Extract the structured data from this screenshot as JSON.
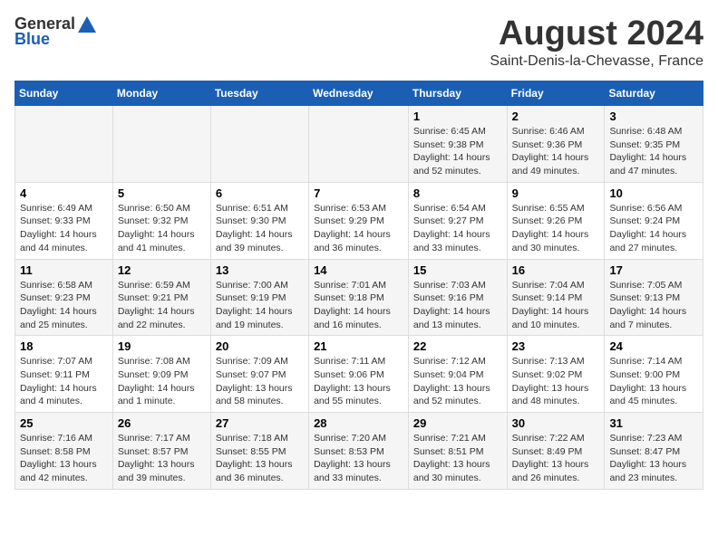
{
  "logo": {
    "general": "General",
    "blue": "Blue"
  },
  "title": "August 2024",
  "subtitle": "Saint-Denis-la-Chevasse, France",
  "weekdays": [
    "Sunday",
    "Monday",
    "Tuesday",
    "Wednesday",
    "Thursday",
    "Friday",
    "Saturday"
  ],
  "weeks": [
    [
      {
        "day": "",
        "content": ""
      },
      {
        "day": "",
        "content": ""
      },
      {
        "day": "",
        "content": ""
      },
      {
        "day": "",
        "content": ""
      },
      {
        "day": "1",
        "content": "Sunrise: 6:45 AM\nSunset: 9:38 PM\nDaylight: 14 hours\nand 52 minutes."
      },
      {
        "day": "2",
        "content": "Sunrise: 6:46 AM\nSunset: 9:36 PM\nDaylight: 14 hours\nand 49 minutes."
      },
      {
        "day": "3",
        "content": "Sunrise: 6:48 AM\nSunset: 9:35 PM\nDaylight: 14 hours\nand 47 minutes."
      }
    ],
    [
      {
        "day": "4",
        "content": "Sunrise: 6:49 AM\nSunset: 9:33 PM\nDaylight: 14 hours\nand 44 minutes."
      },
      {
        "day": "5",
        "content": "Sunrise: 6:50 AM\nSunset: 9:32 PM\nDaylight: 14 hours\nand 41 minutes."
      },
      {
        "day": "6",
        "content": "Sunrise: 6:51 AM\nSunset: 9:30 PM\nDaylight: 14 hours\nand 39 minutes."
      },
      {
        "day": "7",
        "content": "Sunrise: 6:53 AM\nSunset: 9:29 PM\nDaylight: 14 hours\nand 36 minutes."
      },
      {
        "day": "8",
        "content": "Sunrise: 6:54 AM\nSunset: 9:27 PM\nDaylight: 14 hours\nand 33 minutes."
      },
      {
        "day": "9",
        "content": "Sunrise: 6:55 AM\nSunset: 9:26 PM\nDaylight: 14 hours\nand 30 minutes."
      },
      {
        "day": "10",
        "content": "Sunrise: 6:56 AM\nSunset: 9:24 PM\nDaylight: 14 hours\nand 27 minutes."
      }
    ],
    [
      {
        "day": "11",
        "content": "Sunrise: 6:58 AM\nSunset: 9:23 PM\nDaylight: 14 hours\nand 25 minutes."
      },
      {
        "day": "12",
        "content": "Sunrise: 6:59 AM\nSunset: 9:21 PM\nDaylight: 14 hours\nand 22 minutes."
      },
      {
        "day": "13",
        "content": "Sunrise: 7:00 AM\nSunset: 9:19 PM\nDaylight: 14 hours\nand 19 minutes."
      },
      {
        "day": "14",
        "content": "Sunrise: 7:01 AM\nSunset: 9:18 PM\nDaylight: 14 hours\nand 16 minutes."
      },
      {
        "day": "15",
        "content": "Sunrise: 7:03 AM\nSunset: 9:16 PM\nDaylight: 14 hours\nand 13 minutes."
      },
      {
        "day": "16",
        "content": "Sunrise: 7:04 AM\nSunset: 9:14 PM\nDaylight: 14 hours\nand 10 minutes."
      },
      {
        "day": "17",
        "content": "Sunrise: 7:05 AM\nSunset: 9:13 PM\nDaylight: 14 hours\nand 7 minutes."
      }
    ],
    [
      {
        "day": "18",
        "content": "Sunrise: 7:07 AM\nSunset: 9:11 PM\nDaylight: 14 hours\nand 4 minutes."
      },
      {
        "day": "19",
        "content": "Sunrise: 7:08 AM\nSunset: 9:09 PM\nDaylight: 14 hours\nand 1 minute."
      },
      {
        "day": "20",
        "content": "Sunrise: 7:09 AM\nSunset: 9:07 PM\nDaylight: 13 hours\nand 58 minutes."
      },
      {
        "day": "21",
        "content": "Sunrise: 7:11 AM\nSunset: 9:06 PM\nDaylight: 13 hours\nand 55 minutes."
      },
      {
        "day": "22",
        "content": "Sunrise: 7:12 AM\nSunset: 9:04 PM\nDaylight: 13 hours\nand 52 minutes."
      },
      {
        "day": "23",
        "content": "Sunrise: 7:13 AM\nSunset: 9:02 PM\nDaylight: 13 hours\nand 48 minutes."
      },
      {
        "day": "24",
        "content": "Sunrise: 7:14 AM\nSunset: 9:00 PM\nDaylight: 13 hours\nand 45 minutes."
      }
    ],
    [
      {
        "day": "25",
        "content": "Sunrise: 7:16 AM\nSunset: 8:58 PM\nDaylight: 13 hours\nand 42 minutes."
      },
      {
        "day": "26",
        "content": "Sunrise: 7:17 AM\nSunset: 8:57 PM\nDaylight: 13 hours\nand 39 minutes."
      },
      {
        "day": "27",
        "content": "Sunrise: 7:18 AM\nSunset: 8:55 PM\nDaylight: 13 hours\nand 36 minutes."
      },
      {
        "day": "28",
        "content": "Sunrise: 7:20 AM\nSunset: 8:53 PM\nDaylight: 13 hours\nand 33 minutes."
      },
      {
        "day": "29",
        "content": "Sunrise: 7:21 AM\nSunset: 8:51 PM\nDaylight: 13 hours\nand 30 minutes."
      },
      {
        "day": "30",
        "content": "Sunrise: 7:22 AM\nSunset: 8:49 PM\nDaylight: 13 hours\nand 26 minutes."
      },
      {
        "day": "31",
        "content": "Sunrise: 7:23 AM\nSunset: 8:47 PM\nDaylight: 13 hours\nand 23 minutes."
      }
    ]
  ]
}
